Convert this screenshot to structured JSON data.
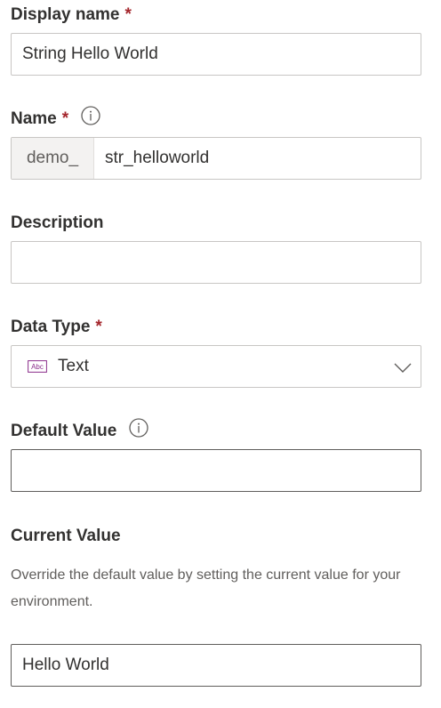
{
  "display_name": {
    "label": "Display name",
    "required_mark": "*",
    "value": "String Hello World"
  },
  "name": {
    "label": "Name",
    "required_mark": "*",
    "prefix": "demo_",
    "value": "str_helloworld",
    "info_icon": "info-icon"
  },
  "description": {
    "label": "Description",
    "value": ""
  },
  "data_type": {
    "label": "Data Type",
    "required_mark": "*",
    "selected": "Text",
    "type_icon": "abc-text-icon",
    "dropdown_icon": "chevron-down-icon"
  },
  "default_value": {
    "label": "Default Value",
    "value": "",
    "info_icon": "info-icon"
  },
  "current_value": {
    "label": "Current Value",
    "helper": "Override the default value by setting the current value for your environment.",
    "value": "Hello World"
  },
  "colors": {
    "required": "#a4262c",
    "text": "#323130",
    "muted": "#605e5c",
    "border": "#c8c6c4",
    "prefix_bg": "#f3f2f1",
    "type_icon": "#8a2d8a"
  }
}
